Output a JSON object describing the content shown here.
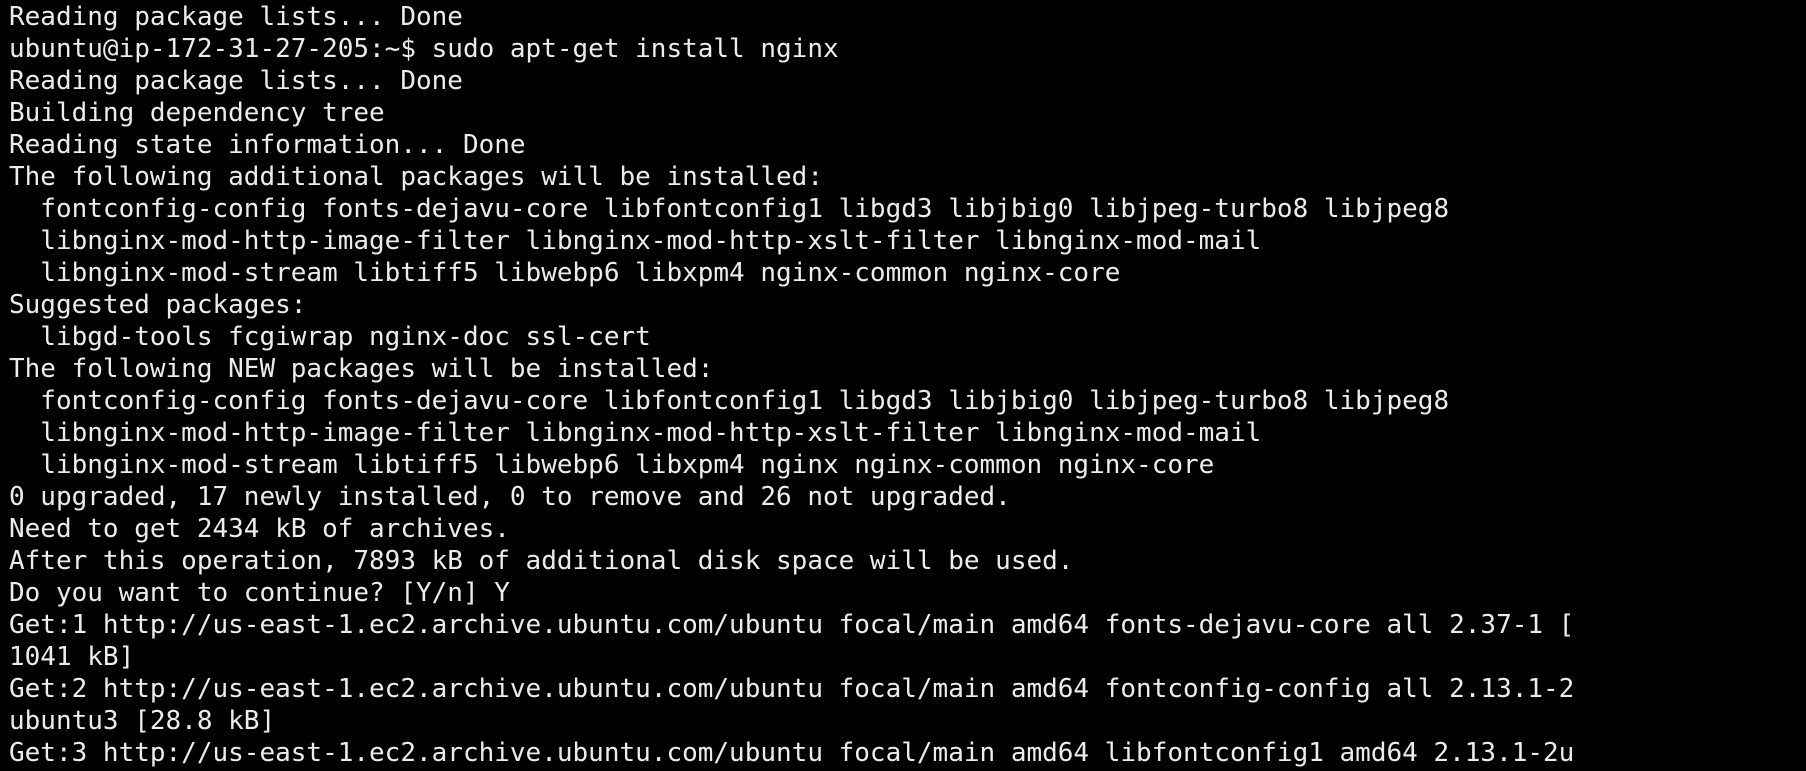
{
  "terminal": {
    "lines": [
      "Reading package lists... Done",
      "ubuntu@ip-172-31-27-205:~$ sudo apt-get install nginx",
      "Reading package lists... Done",
      "Building dependency tree",
      "Reading state information... Done",
      "The following additional packages will be installed:",
      "  fontconfig-config fonts-dejavu-core libfontconfig1 libgd3 libjbig0 libjpeg-turbo8 libjpeg8",
      "  libnginx-mod-http-image-filter libnginx-mod-http-xslt-filter libnginx-mod-mail",
      "  libnginx-mod-stream libtiff5 libwebp6 libxpm4 nginx-common nginx-core",
      "Suggested packages:",
      "  libgd-tools fcgiwrap nginx-doc ssl-cert",
      "The following NEW packages will be installed:",
      "  fontconfig-config fonts-dejavu-core libfontconfig1 libgd3 libjbig0 libjpeg-turbo8 libjpeg8",
      "  libnginx-mod-http-image-filter libnginx-mod-http-xslt-filter libnginx-mod-mail",
      "  libnginx-mod-stream libtiff5 libwebp6 libxpm4 nginx nginx-common nginx-core",
      "0 upgraded, 17 newly installed, 0 to remove and 26 not upgraded.",
      "Need to get 2434 kB of archives.",
      "After this operation, 7893 kB of additional disk space will be used.",
      "Do you want to continue? [Y/n] Y",
      "Get:1 http://us-east-1.ec2.archive.ubuntu.com/ubuntu focal/main amd64 fonts-dejavu-core all 2.37-1 [",
      "1041 kB]",
      "Get:2 http://us-east-1.ec2.archive.ubuntu.com/ubuntu focal/main amd64 fontconfig-config all 2.13.1-2",
      "ubuntu3 [28.8 kB]",
      "Get:3 http://us-east-1.ec2.archive.ubuntu.com/ubuntu focal/main amd64 libfontconfig1 amd64 2.13.1-2u"
    ]
  }
}
